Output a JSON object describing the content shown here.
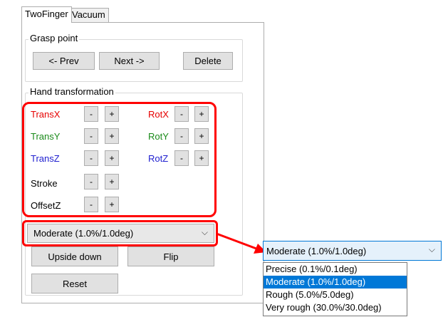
{
  "tabs": [
    {
      "label": "TwoFinger",
      "active": true
    },
    {
      "label": "Vacuum",
      "active": false
    }
  ],
  "grasp_point": {
    "title": "Grasp point",
    "prev": "<- Prev",
    "next": "Next ->",
    "delete": "Delete"
  },
  "hand_transformation": {
    "title": "Hand transformation",
    "rows": [
      {
        "left": "TransX",
        "right": "RotX"
      },
      {
        "left": "TransY",
        "right": "RotY"
      },
      {
        "left": "TransZ",
        "right": "RotZ"
      },
      {
        "left": "Stroke"
      },
      {
        "left": "OffsetZ"
      }
    ],
    "minus": "-",
    "plus": "+"
  },
  "precision_combo": {
    "value": "Moderate (1.0%/1.0deg)",
    "arrow": "⌵"
  },
  "actions": {
    "upside_down": "Upside down",
    "flip": "Flip",
    "reset": "Reset"
  },
  "dropdown_expanded": {
    "value": "Moderate (1.0%/1.0deg)",
    "arrow": "⌵",
    "options": [
      "Precise (0.1%/0.1deg)",
      "Moderate (1.0%/1.0deg)",
      "Rough (5.0%/5.0deg)",
      "Very rough (30.0%/30.0deg)"
    ],
    "selected_index": 1
  },
  "colors": {
    "trans_x": "#e60000",
    "rot_x": "#e60000",
    "trans_y": "#1a8a1a",
    "rot_y": "#1a8a1a",
    "trans_z": "#2020d0",
    "rot_z": "#2020d0",
    "highlight": "#ff0000",
    "selected": "#0078d7"
  }
}
